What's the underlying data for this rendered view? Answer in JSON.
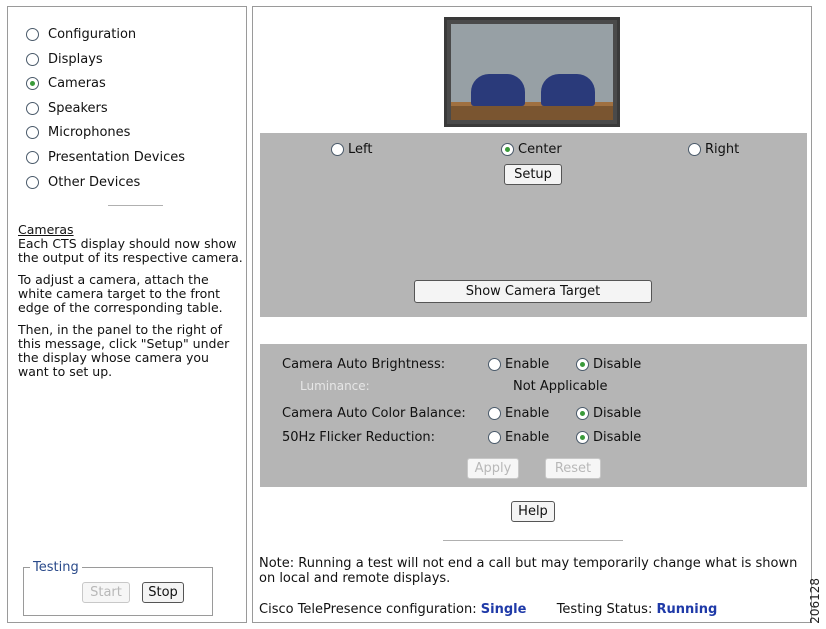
{
  "nav": {
    "items": [
      {
        "label": "Configuration",
        "selected": false
      },
      {
        "label": "Displays",
        "selected": false
      },
      {
        "label": "Cameras",
        "selected": true
      },
      {
        "label": "Speakers",
        "selected": false
      },
      {
        "label": "Microphones",
        "selected": false
      },
      {
        "label": "Presentation Devices",
        "selected": false
      },
      {
        "label": "Other Devices",
        "selected": false
      }
    ]
  },
  "help": {
    "title": "Cameras",
    "p1": "Each CTS display should now show the output of its respective camera.",
    "p2": "To adjust a camera, attach the white camera target to the front edge of the corresponding table.",
    "p3": "Then, in the panel to the right of this message, click \"Setup\" under the display whose camera you want to set up."
  },
  "testing": {
    "legend": "Testing",
    "start_label": "Start",
    "stop_label": "Stop"
  },
  "camera": {
    "positions": [
      {
        "label": "Left",
        "selected": false
      },
      {
        "label": "Center",
        "selected": true
      },
      {
        "label": "Right",
        "selected": false
      }
    ],
    "setup_label": "Setup",
    "show_target_label": "Show Camera Target"
  },
  "settings": {
    "auto_brightness": {
      "label": "Camera Auto Brightness:",
      "enable": "Enable",
      "disable": "Disable",
      "value": "Disable"
    },
    "luminance": {
      "label": "Luminance:",
      "value": "Not Applicable"
    },
    "auto_color_balance": {
      "label": "Camera Auto Color Balance:",
      "enable": "Enable",
      "disable": "Disable",
      "value": "Disable"
    },
    "flicker_reduction": {
      "label": "50Hz Flicker Reduction:",
      "enable": "Enable",
      "disable": "Disable",
      "value": "Disable"
    },
    "apply_label": "Apply",
    "reset_label": "Reset"
  },
  "help_button_label": "Help",
  "note": "Note: Running a test will not end a call but may temporarily change what is shown on local and remote displays.",
  "status": {
    "config_label": "Cisco TelePresence configuration:",
    "config_value": "Single",
    "testing_label": "Testing Status:",
    "testing_value": "Running"
  },
  "figure_number": "206128"
}
